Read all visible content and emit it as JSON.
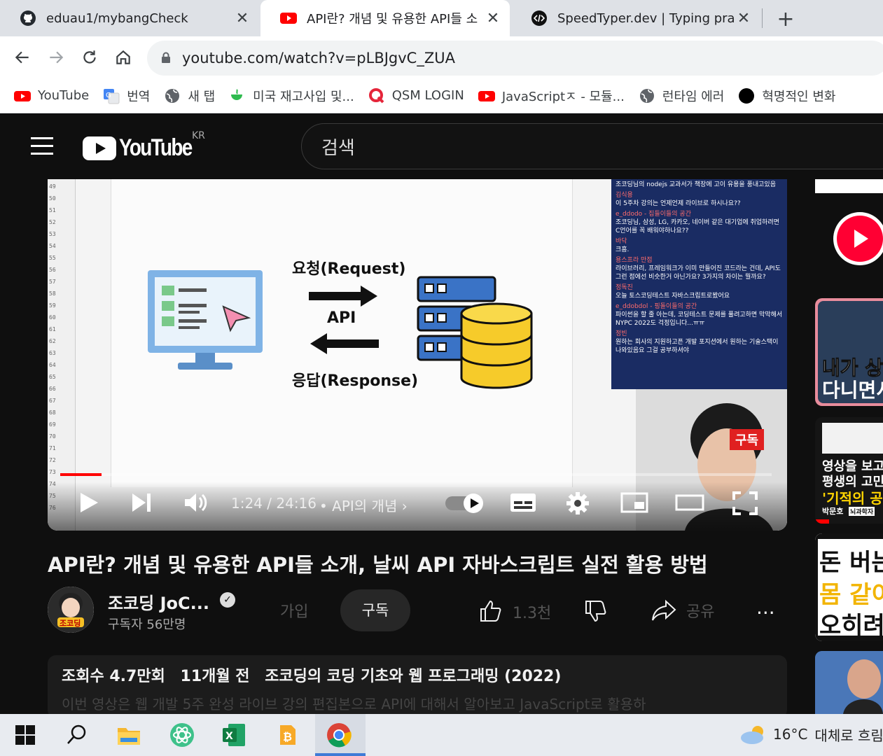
{
  "tabs": [
    {
      "label": "eduau1/mybangCheck",
      "icon": "github-icon"
    },
    {
      "label": "API란? 개념 및 유용한 API들 소",
      "icon": "youtube-icon"
    },
    {
      "label": "SpeedTyper.dev | Typing practic",
      "icon": "code-icon"
    }
  ],
  "address": {
    "url": "youtube.com/watch?v=pLBJgvC_ZUA"
  },
  "bookmarks": [
    {
      "label": "YouTube",
      "icon": "youtube-icon"
    },
    {
      "label": "번역",
      "icon": "translate-icon"
    },
    {
      "label": "새 탭",
      "icon": "globe-icon"
    },
    {
      "label": "미국 재고사입 및...",
      "icon": "cup-icon"
    },
    {
      "label": "QSM LOGIN",
      "icon": "q-icon"
    },
    {
      "label": "JavaScriptㅈ - 모듈...",
      "icon": "youtube-icon"
    },
    {
      "label": "런타임 에러",
      "icon": "globe-icon"
    },
    {
      "label": "혁명적인 변화",
      "icon": "circle-icon"
    }
  ],
  "youtube": {
    "logo_text": "YouTube",
    "country": "KR",
    "search_placeholder": "검색"
  },
  "video": {
    "slide": {
      "request": "요청(Request)",
      "api": "API",
      "response": "응답(Response)"
    },
    "line_numbers": [
      "49",
      "50",
      "51",
      "52",
      "53",
      "54",
      "55",
      "56",
      "57",
      "58",
      "59",
      "60",
      "61",
      "62",
      "63",
      "64",
      "65",
      "66",
      "67",
      "68",
      "69",
      "70",
      "71",
      "72",
      "73",
      "74",
      "75",
      "76"
    ],
    "chat": [
      {
        "who": "",
        "text": "조코딩님의 nodejs 교과서가 책장에 고이 유용을 풍내고있음"
      },
      {
        "who": "김식용",
        "text": "이 5주차 강의는 언제언제 라이브로 하시나요??"
      },
      {
        "who": "e_ddodo - 집들이들의 공간",
        "text": "조코딩님, 삼성, LG, 카카오, 네이버 같은 대기업에 취업하려면 C언어를 꼭 배워야하나요??"
      },
      {
        "who": "바닥",
        "text": "크흠."
      },
      {
        "who": "용스프라 만점",
        "text": "라이브러리, 프레임워크가 이미 만들어진 코드라는 건데, API도 그런 점에선 비슷한거 아닌가요? 3가지의 차이는 뭘까요?"
      },
      {
        "who": "정독진",
        "text": "오늘 토스코딩테스트 자바스크립트로봤어요"
      },
      {
        "who": "e_ddobdol - 핑돌이들의 공간",
        "text": "파이썬을 할 줄 아는데, 코딩테스트 문제를 풀려고하면 막막해서 NYPC 2022도 걱정입니다...ㅠㅠ"
      },
      {
        "who": "정빈",
        "text": "원하는 회사의 지원하고픈 개발 포지션에서 원하는 기술스택이 나와있음요 그걸 공부하셔야"
      }
    ],
    "subscribe_tag": "구독",
    "progress_fraction": 0.058,
    "time": "1:24 / 24:16",
    "chapter": "• API의 개념 ›"
  },
  "title": "API란? 개념 및 유용한 API들 소개, 날씨 API 자바스크립트 실전 활용 방법",
  "channel": {
    "name": "조코딩 JoC...",
    "subscribers": "구독자 56만명",
    "avatar_text": "조코딩"
  },
  "actions": {
    "join": "가입",
    "subscribe": "구독",
    "likes": "1.3천",
    "share": "공유",
    "more": "..."
  },
  "description": {
    "views": "조회수 4.7만회",
    "age": "11개월 전",
    "playlist": "조코딩의 코딩 기초와 웹 프로그래밍 (2022)",
    "body": "이번 영상은 웹 개발 5주 완성 라이브 강의 편집본으로 API에 대해서 알아보고 JavaScript로 활용하"
  },
  "rail": {
    "thumb2_line1": "내가 상",
    "thumb2_line2": "다니면서",
    "thumb3_line1": "영상을 보고",
    "thumb3_line2": "평생의 고민이",
    "thumb3_line3": "'기적의 공",
    "thumb3_tag": "박문호",
    "thumb3_tag2": "뇌과학자",
    "thumb4_line1": "돈 버는",
    "thumb4_line2": "몸 같이",
    "thumb4_line3": "오히려"
  },
  "taskbar": {
    "weather_temp": "16°C",
    "weather_text": "대체로 흐림"
  },
  "colors": {
    "youtube_red": "#ff0000",
    "bg": "#0f0f0f"
  }
}
